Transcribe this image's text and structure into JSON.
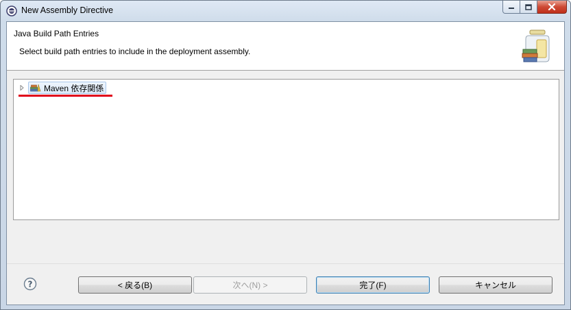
{
  "window": {
    "title": "New Assembly Directive"
  },
  "header": {
    "title": "Java Build Path Entries",
    "description": "Select build path entries to include in the deployment assembly."
  },
  "tree": {
    "items": [
      {
        "label": "Maven 依存関係",
        "icon": "library-icon",
        "expanded": false,
        "selected": true
      }
    ]
  },
  "buttons": {
    "back": "< 戻る(B)",
    "next": "次へ(N) >",
    "finish": "完了(F)",
    "cancel": "キャンセル"
  },
  "colors": {
    "highlight_underline": "#e0001a",
    "dialog_background": "#f0f0f0"
  }
}
